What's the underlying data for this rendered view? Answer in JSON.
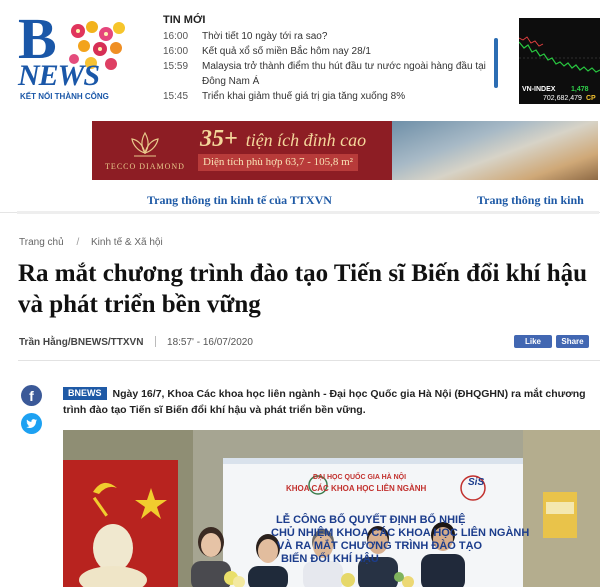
{
  "header": {
    "logo": {
      "mark": "B",
      "wordmark": "NEWS",
      "slogan": "KẾT NỐI THÀNH CÔNG"
    },
    "latest_news": {
      "title": "TIN MỚI",
      "items": [
        {
          "time": "16:00",
          "text": "Thời tiết 10 ngày tới ra sao?"
        },
        {
          "time": "16:00",
          "text": "Kết quả xổ số miền Bắc hôm nay 28/1"
        },
        {
          "time": "15:59",
          "text": "Malaysia trở thành điểm thu hút đầu tư nước ngoài hàng đầu tại Đông Nam Á"
        },
        {
          "time": "15:45",
          "text": "Triển khai giảm thuế giá trị gia tăng xuống 8%"
        }
      ]
    },
    "market": {
      "index_name": "VN-INDEX",
      "index_value": "1,478",
      "volume": "702,682,479",
      "cp_label": "CP"
    }
  },
  "ad_banner": {
    "brand": "TECCO DIAMOND",
    "headline_number": "35+",
    "headline_text": "tiện ích đỉnh cao",
    "subline": "Diện tích phù hợp 63,7 - 105,8 m²"
  },
  "nav": {
    "left_link": "Trang thông tin kinh tế của TTXVN",
    "right_link": "Trang thông tin kinh"
  },
  "article": {
    "breadcrumb": [
      "Trang chủ",
      "Kinh tế & Xã hội"
    ],
    "title": "Ra mắt chương trình đào tạo Tiến sĩ Biến đổi khí hậu và phát triển bền vững",
    "author": "Trần Hằng/BNEWS/TTXVN",
    "datetime": "18:57' - 16/07/2020",
    "fb_like_label": "Like",
    "fb_share_label": "Share",
    "sapo_tag": "BNEWS",
    "sapo": "Ngày 16/7, Khoa Các khoa học liên ngành - Đại học Quốc gia Hà Nội (ĐHQGHN) ra mắt chương trình đào tạo Tiến sĩ Biến đổi khí hậu và phát triển bền vững.",
    "photo": {
      "banner_university": "ĐẠI HỌC QUỐC GIA HÀ NỘI",
      "banner_school": "KHOA CÁC KHOA HỌC LIÊN NGÀNH",
      "banner_line1": "LỄ CÔNG BỐ QUYẾT ĐỊNH BỔ NHIỆ",
      "banner_line2": "CHỦ NHIỆM KHOA CÁC KHOA HỌC LIÊN NGÀNH",
      "banner_line3": "VÀ RA MẮT CHƯƠNG TRÌNH ĐÀO TẠO",
      "banner_line4": "BIẾN ĐỔI KHÍ HẬU",
      "logo_text": "SiS"
    }
  },
  "social": {
    "facebook_glyph": "f",
    "twitter_label": "twitter"
  },
  "colors": {
    "brand_blue": "#1f5aa6",
    "banner_red": "#8d1d24",
    "gold": "#f4d79b",
    "facebook": "#3b5998",
    "twitter": "#1da1f2"
  }
}
